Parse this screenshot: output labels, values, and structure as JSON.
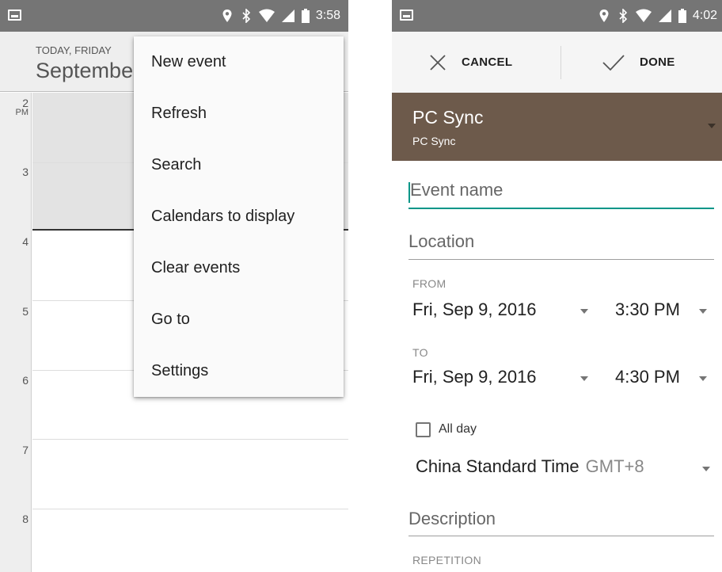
{
  "left_screen": {
    "status_bar": {
      "time": "3:58",
      "icons": [
        "image-notification-icon",
        "location-icon",
        "bluetooth-icon",
        "wifi-icon",
        "cell-signal-icon",
        "battery-icon"
      ]
    },
    "header": {
      "today_label": "TODAY, FRIDAY",
      "month": "September"
    },
    "hours": [
      {
        "label": "2",
        "ampm": "PM"
      },
      {
        "label": "3",
        "ampm": ""
      },
      {
        "label": "4",
        "ampm": ""
      },
      {
        "label": "5",
        "ampm": ""
      },
      {
        "label": "6",
        "ampm": ""
      },
      {
        "label": "7",
        "ampm": ""
      },
      {
        "label": "8",
        "ampm": ""
      }
    ],
    "menu": {
      "items": [
        "New event",
        "Refresh",
        "Search",
        "Calendars to display",
        "Clear events",
        "Go to",
        "Settings"
      ]
    }
  },
  "right_screen": {
    "status_bar": {
      "time": "4:02",
      "icons": [
        "image-notification-icon",
        "location-icon",
        "bluetooth-icon",
        "wifi-icon",
        "cell-signal-icon",
        "battery-icon"
      ]
    },
    "action_bar": {
      "cancel_label": "CANCEL",
      "done_label": "DONE"
    },
    "calendar": {
      "name": "PC Sync",
      "account": "PC Sync",
      "color": "#6d5a4b"
    },
    "event_name": {
      "placeholder": "Event name"
    },
    "location": {
      "placeholder": "Location"
    },
    "from": {
      "label": "FROM",
      "date": "Fri, Sep 9, 2016",
      "time": "3:30 PM"
    },
    "to": {
      "label": "TO",
      "date": "Fri, Sep 9, 2016",
      "time": "4:30 PM"
    },
    "all_day": {
      "label": "All day",
      "checked": false
    },
    "timezone": {
      "name": "China Standard Time",
      "offset": "GMT+8"
    },
    "description": {
      "placeholder": "Description"
    },
    "repetition": {
      "label": "REPETITION"
    },
    "accent_color": "#009688"
  }
}
